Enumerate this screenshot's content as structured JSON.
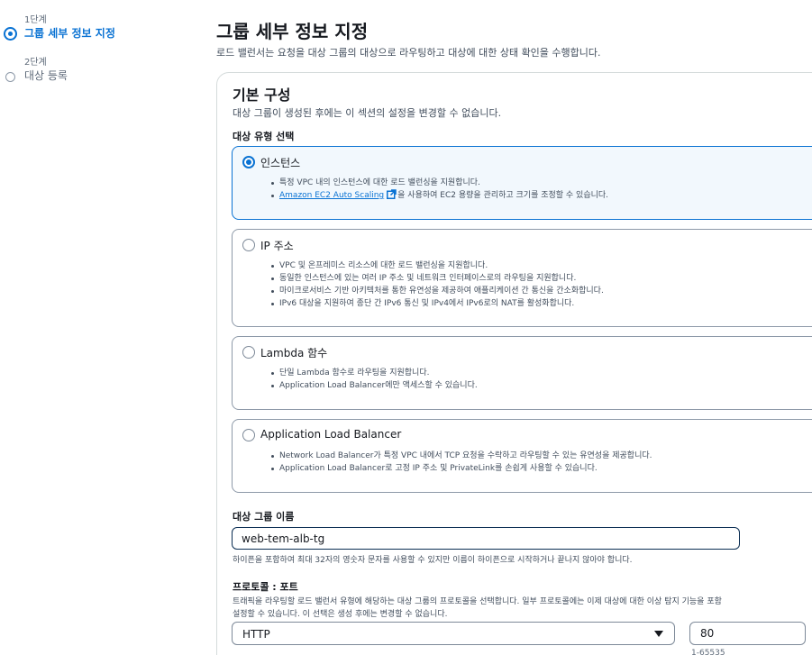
{
  "stepper": {
    "steps": [
      {
        "number": "1단계",
        "label": "그룹 세부 정보 지정",
        "state": "active"
      },
      {
        "number": "2단계",
        "label": "대상 등록",
        "state": "inactive"
      }
    ]
  },
  "header": {
    "title": "그룹 세부 정보 지정",
    "description": "로드 밸런서는 요청을 대상 그룹의 대상으로 라우팅하고 대상에 대한 상태 확인을 수행합니다."
  },
  "basic_config": {
    "title": "기본 구성",
    "description": "대상 그룹이 생성된 후에는 이 섹션의 설정을 변경할 수 없습니다.",
    "target_type_label": "대상 유형 선택",
    "options": [
      {
        "label": "인스턴스",
        "selected": true,
        "bullets": [
          "특정 VPC 내의 인스턴스에 대한 로드 밸런싱을 지원합니다.",
          "을 사용하여 EC2 용량을 관리하고 크기를 조정할 수 있습니다."
        ],
        "link_text": "Amazon EC2 Auto Scaling"
      },
      {
        "label": "IP 주소",
        "selected": false,
        "bullets": [
          "VPC 및 온프레미스 리소스에 대한 로드 밸런싱을 지원합니다.",
          "동일한 인스턴스에 있는 여러 IP 주소 및 네트워크 인터페이스로의 라우팅을 지원합니다.",
          "마이크로서비스 기반 아키텍처를 통한 유연성을 제공하여 애플리케이션 간 통신을 간소화합니다.",
          "IPv6 대상을 지원하여 종단 간 IPv6 통신 및 IPv4에서 IPv6로의 NAT를 활성화합니다."
        ]
      },
      {
        "label": "Lambda 함수",
        "selected": false,
        "bullets": [
          "단일 Lambda 함수로 라우팅을 지원합니다.",
          "Application Load Balancer에만 액세스할 수 있습니다."
        ]
      },
      {
        "label": "Application Load Balancer",
        "selected": false,
        "bullets": [
          "Network Load Balancer가 특정 VPC 내에서 TCP 요청을 수락하고 라우팅할 수 있는 유연성을 제공합니다.",
          "Application Load Balancer로 고정 IP 주소 및 PrivateLink를 손쉽게 사용할 수 있습니다."
        ]
      }
    ]
  },
  "target_group_name": {
    "label": "대상 그룹 이름",
    "value": "web-tem-alb-tg",
    "help": "하이픈을 포함하여 최대 32자의 영숫자 문자를 사용할 수 있지만 이름이 하이픈으로 시작하거나 끝나지 않아야 합니다."
  },
  "protocol_port": {
    "label": "프로토콜 : 포트",
    "description_line1": "트래픽을 라우팅할 로드 밸런서 유형에 해당하는 대상 그룹의 프로토콜을 선택합니다. 일부 프로토콜에는 이제 대상에 대한 이상 탐지 기능을 포함",
    "description_line2": "설정할 수 있습니다. 이 선택은 생성 후에는 변경할 수 없습니다.",
    "protocol_value": "HTTP",
    "port_value": "80",
    "port_hint": "1-65535"
  },
  "colors": {
    "accent": "#0972d3",
    "selected_tile_bg": "#f2f8fd",
    "text": "#16191f",
    "muted_text": "#414d5c"
  },
  "icons": {
    "external_link": "external-link-icon",
    "select_caret": "caret-down-icon"
  }
}
